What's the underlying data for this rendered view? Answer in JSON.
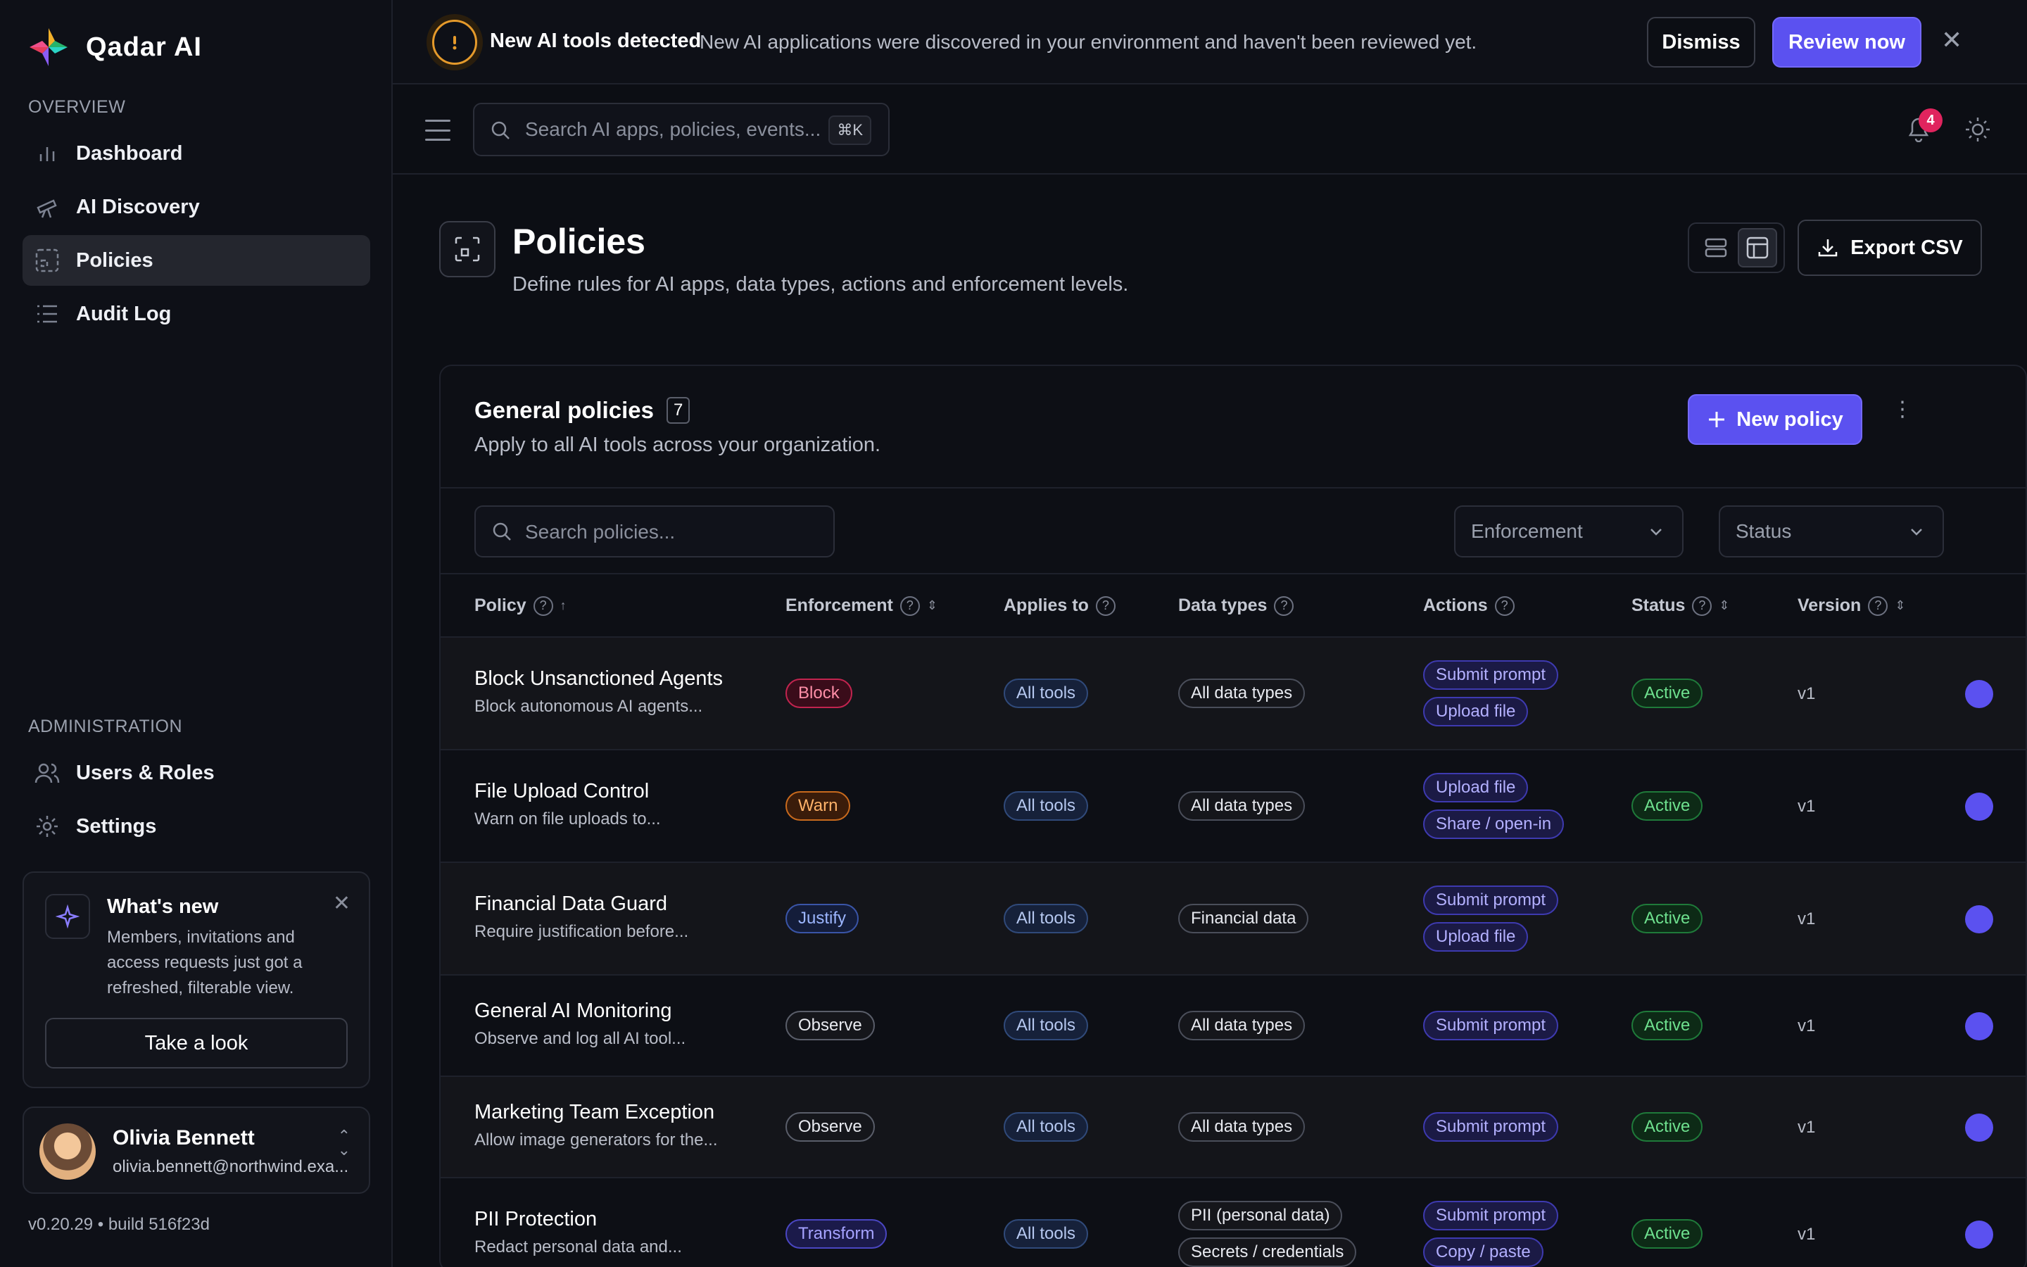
{
  "app": {
    "name": "Qadar AI"
  },
  "sidebar": {
    "overview_label": "OVERVIEW",
    "admin_label": "ADMINISTRATION",
    "items": [
      {
        "label": "Dashboard",
        "icon": "bar-chart-icon"
      },
      {
        "label": "AI Discovery",
        "icon": "telescope-icon"
      },
      {
        "label": "Policies",
        "icon": "policy-frame-icon",
        "active": true
      },
      {
        "label": "Audit Log",
        "icon": "list-icon"
      }
    ],
    "admin_items": [
      {
        "label": "Users & Roles",
        "icon": "users-icon"
      },
      {
        "label": "Settings",
        "icon": "gear-icon"
      }
    ],
    "whats_new": {
      "title": "What's new",
      "text": "Members, invitations and access requests just got a refreshed, filterable view.",
      "button": "Take a look"
    },
    "user": {
      "name": "Olivia Bennett",
      "email": "olivia.bennett@northwind.exa..."
    },
    "version": "v0.20.29 • build 516f23d"
  },
  "banner": {
    "title": "New AI tools detected",
    "text": "New AI applications were discovered in your environment and haven't been reviewed yet.",
    "dismiss": "Dismiss",
    "review": "Review now"
  },
  "topbar": {
    "search_placeholder": "Search AI apps, policies, events...",
    "shortcut": "⌘K",
    "notifications": "4"
  },
  "page": {
    "title": "Policies",
    "subtitle": "Define rules for AI apps, data types, actions and enforcement levels.",
    "export": "Export CSV"
  },
  "card": {
    "title": "General policies",
    "count": "7",
    "subtitle": "Apply to all AI tools across your organization.",
    "new_policy": "New policy",
    "search_placeholder": "Search policies...",
    "filters": {
      "enforcement": "Enforcement",
      "status": "Status"
    },
    "columns": {
      "policy": "Policy",
      "enforcement": "Enforcement",
      "applies": "Applies to",
      "data": "Data types",
      "actions": "Actions",
      "status": "Status",
      "version": "Version"
    },
    "rows": [
      {
        "name": "Block Unsanctioned Agents",
        "desc": "Block autonomous AI agents...",
        "enforcement": "Block",
        "applies": "All tools",
        "data": [
          "All data types"
        ],
        "actions": [
          "Submit prompt",
          "Upload file"
        ],
        "status": "Active",
        "version": "v1"
      },
      {
        "name": "File Upload Control",
        "desc": "Warn on file uploads to...",
        "enforcement": "Warn",
        "applies": "All tools",
        "data": [
          "All data types"
        ],
        "actions": [
          "Upload file",
          "Share / open-in"
        ],
        "status": "Active",
        "version": "v1"
      },
      {
        "name": "Financial Data Guard",
        "desc": "Require justification before...",
        "enforcement": "Justify",
        "applies": "All tools",
        "data": [
          "Financial data"
        ],
        "actions": [
          "Submit prompt",
          "Upload file"
        ],
        "status": "Active",
        "version": "v1"
      },
      {
        "name": "General AI Monitoring",
        "desc": "Observe and log all AI tool...",
        "enforcement": "Observe",
        "applies": "All tools",
        "data": [
          "All data types"
        ],
        "actions": [
          "Submit prompt"
        ],
        "status": "Active",
        "version": "v1"
      },
      {
        "name": "Marketing Team Exception",
        "desc": "Allow image generators for the...",
        "enforcement": "Observe",
        "applies": "All tools",
        "data": [
          "All data types"
        ],
        "actions": [
          "Submit prompt"
        ],
        "status": "Active",
        "version": "v1"
      },
      {
        "name": "PII Protection",
        "desc": "Redact personal data and...",
        "enforcement": "Transform",
        "applies": "All tools",
        "data": [
          "PII (personal data)",
          "Secrets / credentials"
        ],
        "actions": [
          "Submit prompt",
          "Copy / paste"
        ],
        "status": "Active",
        "version": "v1"
      }
    ]
  },
  "colors": {
    "accent": "#5b51f0",
    "bg": "#0c0e14",
    "warning": "#e59a2b"
  }
}
